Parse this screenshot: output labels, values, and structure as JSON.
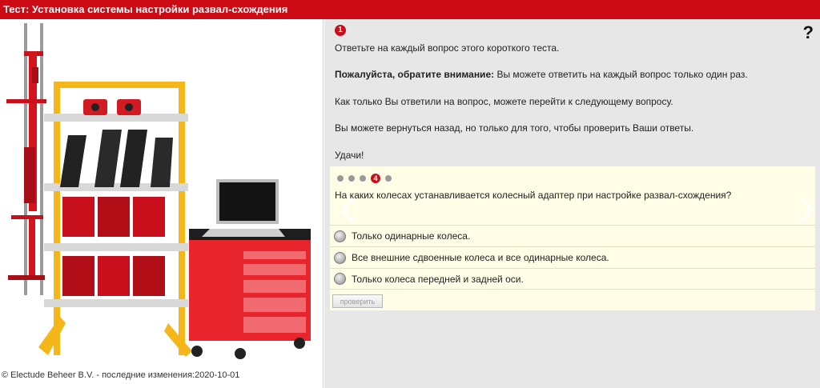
{
  "window": {
    "title": "Тест: Установка системы настройки развал-схождения"
  },
  "illustration": {
    "description_icon": "wheel-alignment-rack-and-red-tool-cabinet-with-laptop"
  },
  "footer": {
    "copyright": "© Electude Beheer B.V. - последние изменения:2020-10-01"
  },
  "quiz": {
    "step_number": "1",
    "help_label": "?",
    "intro": {
      "line1": "Ответьте на каждый вопрос этого короткого теста.",
      "line2_bold": "Пожалуйста, обратите внимание:",
      "line2_rest": " Вы можете ответить на каждый вопрос только один раз.",
      "line3": "Как только Вы ответили на вопрос, можете перейти к следующему вопросу.",
      "line4": "Вы можете вернуться назад, но только для того, чтобы проверить Ваши ответы.",
      "line5": "Удачи!"
    },
    "progress": {
      "total": 5,
      "current": 4,
      "current_label": "4"
    },
    "question": "На каких колесах устанавливается колесный адаптер при настройке развал-схождения?",
    "options": [
      "Только одинарные колеса.",
      "Все внешние сдвоенные колеса и все одинарные колеса.",
      "Только колеса передней и задней оси."
    ],
    "check_button_label": "проверить"
  },
  "colors": {
    "titlebar": "#cc0a14",
    "accent_red": "#c8101c",
    "right_background": "#e7e7e7",
    "question_panel": "#fffde6"
  }
}
